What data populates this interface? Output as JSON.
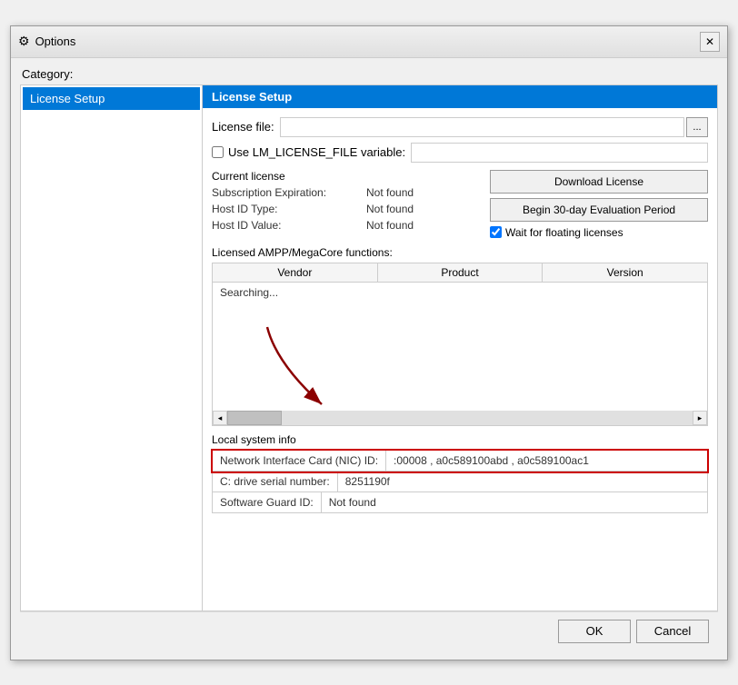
{
  "window": {
    "title": "Options",
    "icon": "⚙"
  },
  "category_label": "Category:",
  "sidebar": {
    "items": [
      {
        "label": "License Setup",
        "selected": true
      }
    ]
  },
  "panel": {
    "title": "License Setup",
    "license_file_label": "License file:",
    "license_file_value": "",
    "browse_label": "...",
    "use_lm_label": "Use LM_LICENSE_FILE variable:",
    "use_lm_value": "",
    "current_license_label": "Current license",
    "subscription_label": "Subscription Expiration:",
    "subscription_value": "Not found",
    "host_id_type_label": "Host ID Type:",
    "host_id_type_value": "Not found",
    "host_id_value_label": "Host ID Value:",
    "host_id_value_value": "Not found",
    "download_license_label": "Download License",
    "begin_eval_label": "Begin 30-day Evaluation Period",
    "wait_floating_label": "Wait for floating licenses",
    "licensed_ampp_label": "Licensed AMPP/MegaCore functions:",
    "table": {
      "columns": [
        "Vendor",
        "Product",
        "Version"
      ],
      "searching_text": "Searching..."
    },
    "local_info_title": "Local system info",
    "nic_label": "Network Interface Card (NIC) ID:",
    "nic_value": ":00008 , a0c589100abd , a0c589100ac1",
    "c_drive_label": "C: drive serial number:",
    "c_drive_value": "8251190f",
    "sg_label": "Software Guard ID:",
    "sg_value": "Not found"
  },
  "buttons": {
    "ok_label": "OK",
    "cancel_label": "Cancel"
  }
}
